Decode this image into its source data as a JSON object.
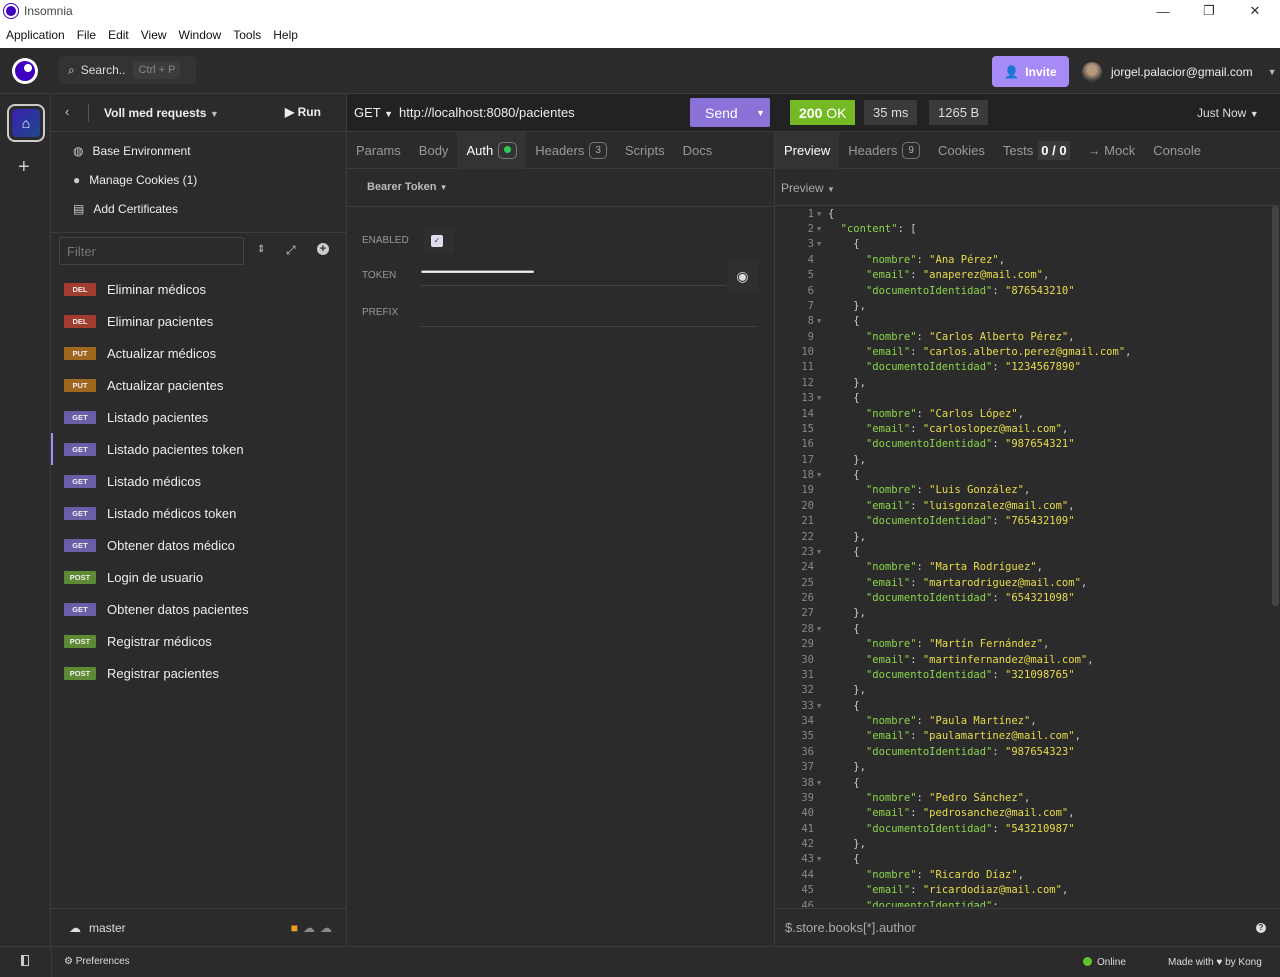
{
  "window": {
    "title": "Insomnia",
    "min": "—",
    "max": "❐",
    "close": "✕"
  },
  "menu": [
    "Application",
    "File",
    "Edit",
    "View",
    "Window",
    "Tools",
    "Help"
  ],
  "topbar": {
    "search": "Search..",
    "shortcut": "Ctrl + P",
    "invite": "Invite",
    "user": "jorgel.palacior@gmail.com"
  },
  "sidebar": {
    "collection": "Voll med requests",
    "run": "Run",
    "links": [
      {
        "label": "Base Environment",
        "icon": "globe-icon"
      },
      {
        "label": "Manage Cookies (1)",
        "icon": "cookie-icon"
      },
      {
        "label": "Add Certificates",
        "icon": "certificate-icon"
      }
    ],
    "filter_placeholder": "Filter",
    "requests": [
      {
        "method": "DEL",
        "name": "Eliminar médicos"
      },
      {
        "method": "DEL",
        "name": "Eliminar pacientes"
      },
      {
        "method": "PUT",
        "name": "Actualizar médicos"
      },
      {
        "method": "PUT",
        "name": "Actualizar pacientes"
      },
      {
        "method": "GET",
        "name": "Listado pacientes"
      },
      {
        "method": "GET",
        "name": "Listado pacientes token",
        "active": true
      },
      {
        "method": "GET",
        "name": "Listado médicos"
      },
      {
        "method": "GET",
        "name": "Listado médicos token"
      },
      {
        "method": "GET",
        "name": "Obtener datos médico"
      },
      {
        "method": "POST",
        "name": "Login de usuario"
      },
      {
        "method": "GET",
        "name": "Obtener datos pacientes"
      },
      {
        "method": "POST",
        "name": "Registrar médicos"
      },
      {
        "method": "POST",
        "name": "Registrar pacientes"
      }
    ],
    "branch": "master"
  },
  "method_colors": {
    "DEL": "#a13c2f",
    "PUT": "#a0671f",
    "GET": "#6a5ea8",
    "POST": "#5d8a35"
  },
  "request": {
    "method": "GET",
    "url": "http://localhost:8080/pacientes",
    "send": "Send",
    "tabs": [
      {
        "label": "Params"
      },
      {
        "label": "Body"
      },
      {
        "label": "Auth",
        "active": true
      },
      {
        "label": "Headers",
        "count": "3"
      },
      {
        "label": "Scripts"
      },
      {
        "label": "Docs"
      }
    ],
    "auth_type": "Bearer Token",
    "enabled_label": "ENABLED",
    "enabled": true,
    "token_label": "TOKEN",
    "token_masked": "••••••••••••••••••••••••••••••••••••••••••••••••••••••••••••••••••••••••",
    "prefix_label": "PREFIX"
  },
  "response": {
    "status": "200",
    "status_text": "OK",
    "time": "35 ms",
    "size": "1265 B",
    "when": "Just Now",
    "tabs": [
      {
        "label": "Preview",
        "active": true
      },
      {
        "label": "Headers",
        "count": "9"
      },
      {
        "label": "Cookies"
      },
      {
        "label": "Tests",
        "count": "0 / 0"
      },
      {
        "label": "→ Mock"
      },
      {
        "label": "Console"
      }
    ],
    "preview_mode": "Preview",
    "filter_placeholder": "$.store.books[*].author",
    "body": {
      "content": [
        {
          "nombre": "Ana Pérez",
          "email": "anaperez@mail.com",
          "documentoIdentidad": "876543210"
        },
        {
          "nombre": "Carlos Alberto Pérez",
          "email": "carlos.alberto.perez@gmail.com",
          "documentoIdentidad": "1234567890"
        },
        {
          "nombre": "Carlos López",
          "email": "carloslopez@mail.com",
          "documentoIdentidad": "987654321"
        },
        {
          "nombre": "Luis González",
          "email": "luisgonzalez@mail.com",
          "documentoIdentidad": "765432109"
        },
        {
          "nombre": "Marta Rodríguez",
          "email": "martarodriguez@mail.com",
          "documentoIdentidad": "654321098"
        },
        {
          "nombre": "Martín Fernández",
          "email": "martinfernandez@mail.com",
          "documentoIdentidad": "321098765"
        },
        {
          "nombre": "Paula Martínez",
          "email": "paulamartinez@mail.com",
          "documentoIdentidad": "987654323"
        },
        {
          "nombre": "Pedro Sánchez",
          "email": "pedrosanchez@mail.com",
          "documentoIdentidad": "543210987"
        },
        {
          "nombre": "Ricardo Díaz",
          "email": "ricardodiaz@mail.com"
        }
      ]
    }
  },
  "statusbar": {
    "preferences": "Preferences",
    "online": "Online",
    "made_with": "Made with",
    "by": "by Kong"
  },
  "colors": {
    "accent": "#a68af6",
    "status_ok": "#75ba24",
    "online": "#62c230"
  }
}
